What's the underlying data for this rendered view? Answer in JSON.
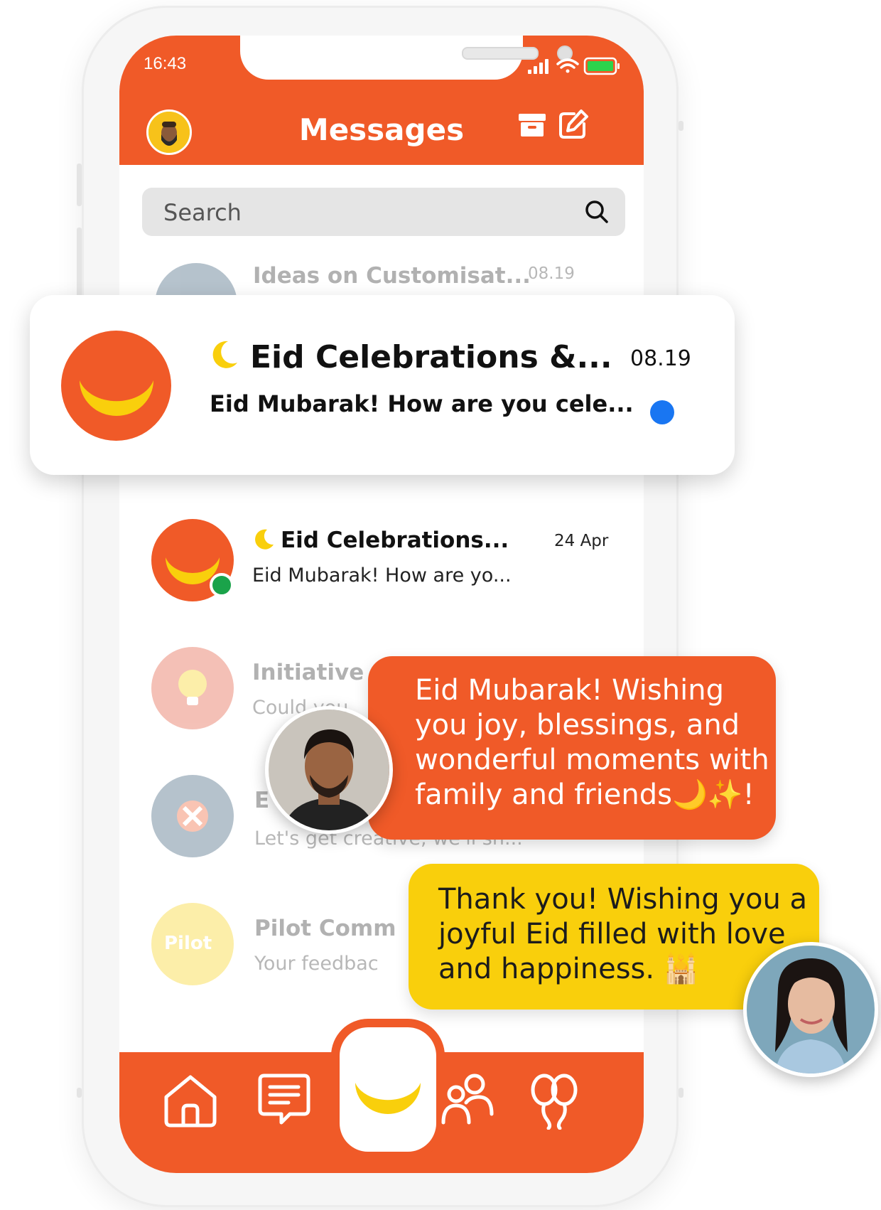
{
  "status_bar": {
    "time": "16:43"
  },
  "header": {
    "title": "Messages"
  },
  "search": {
    "placeholder": "Search"
  },
  "rows": [
    {
      "title": "Ideas on Customisat...",
      "date": "08.19"
    },
    {
      "title": "Eid Celebrations...",
      "subtitle": "Eid Mubarak! How are yo...",
      "date": "24 Apr"
    },
    {
      "title": "Initiative",
      "subtitle": "Could you"
    },
    {
      "title": "E",
      "subtitle": "Let's get creative, we'll sh..."
    },
    {
      "title": "Pilot Comm",
      "subtitle": "Your feedbac",
      "avatar_text": "Pilot"
    }
  ],
  "card": {
    "title": "Eid Celebrations &...",
    "subtitle": "Eid Mubarak! How are you cele...",
    "date": "08.19"
  },
  "bubbles": {
    "incoming": "Eid Mubarak! Wishing you joy, blessings, and wonderful moments with family and friends🌙✨!",
    "outgoing": "Thank you! Wishing you a joyful Eid filled with love and happiness. 🕌"
  },
  "colors": {
    "brand": "#f05a28",
    "accent_yellow": "#f9cf0c",
    "unread": "#1976f2",
    "online": "#1aa34a"
  },
  "icons": [
    "archive-icon",
    "compose-icon",
    "search-icon",
    "crescent-moon-icon",
    "home-icon",
    "chat-icon",
    "people-icon",
    "balloons-icon"
  ]
}
